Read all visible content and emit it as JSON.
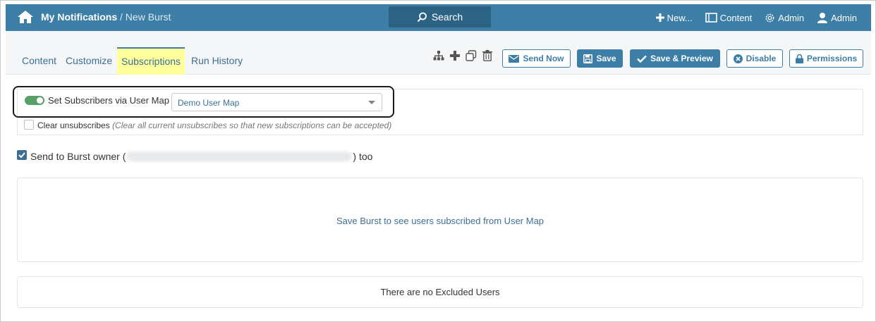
{
  "header": {
    "breadcrumb_root": "My Notifications",
    "breadcrumb_sep": " / ",
    "breadcrumb_leaf": "New Burst",
    "search_label": "Search",
    "new_label": "New...",
    "content_label": "Content",
    "admin_menu_label": "Admin",
    "user_label": "Admin"
  },
  "tabs": [
    {
      "label": "Content"
    },
    {
      "label": "Customize"
    },
    {
      "label": "Subscriptions"
    },
    {
      "label": "Run History"
    }
  ],
  "toolbar": {
    "send_now": "Send Now",
    "save": "Save",
    "save_preview": "Save & Preview",
    "disable": "Disable",
    "permissions": "Permissions"
  },
  "subscribers": {
    "toggle_label": "Set Subscribers via User Map",
    "user_map_value": "Demo User Map",
    "clear_label": "Clear unsubscribes",
    "clear_hint": "(Clear all current unsubscribes so that new subscriptions can be accepted)",
    "owner_prefix": "Send to Burst owner (",
    "owner_suffix": ") too"
  },
  "users_panel": {
    "message": "Save Burst to see users subscribed from User Map"
  },
  "excluded_panel": {
    "message": "There are no Excluded Users"
  },
  "colors": {
    "brand": "#3d7ea6",
    "toggle_on": "#5a9e6a",
    "tab_highlight": "#ffff9e"
  }
}
